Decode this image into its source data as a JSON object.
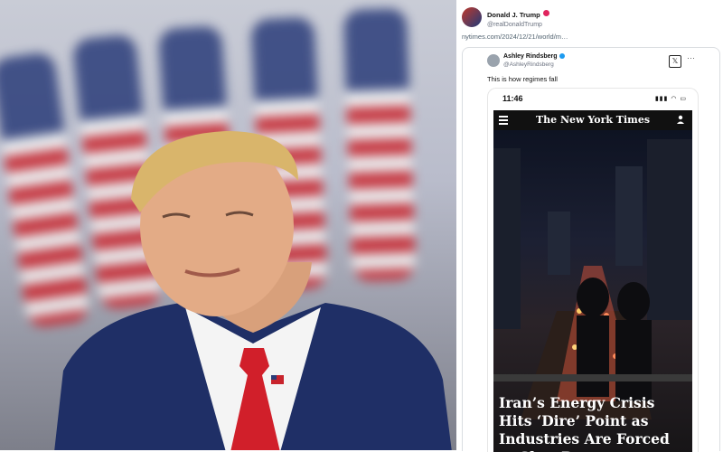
{
  "tweet": {
    "author_name": "Donald J. Trump",
    "author_handle": "@realDonaldTrump",
    "link_text": "nytimes.com/2024/12/21/world/m…"
  },
  "quote": {
    "author_name": "Ashley Rindsberg",
    "author_handle": "@AshleyRindsberg",
    "text": "This is how regimes fall",
    "more_icon": "ellipsis-icon",
    "x_icon": "x-logo-icon"
  },
  "phone": {
    "time": "11:46",
    "status_icons": "▮▮▮ ◠ ▭",
    "masthead": "The New York Times",
    "headline": "Iran’s Energy Crisis Hits ‘Dire’ Point as Industries Are Forced to Shut Down"
  },
  "colors": {
    "verified_pink": "#e0245e",
    "verified_blue": "#1d9bf0",
    "suit_navy": "#1f2f66",
    "tie_red": "#d11f2a"
  }
}
